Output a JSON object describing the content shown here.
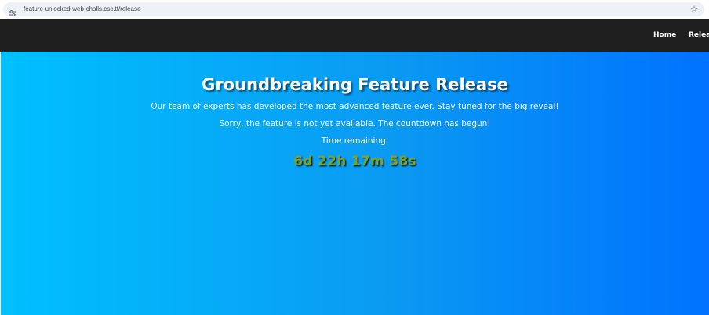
{
  "browser": {
    "url": "feature-unlocked-web-challs.csc.tf/release",
    "site_info_icon": "tune-icon",
    "bookmark_icon": "star-icon"
  },
  "nav": {
    "items": [
      {
        "label": "Home"
      },
      {
        "label": "Release"
      }
    ],
    "background": "#1f1f1f"
  },
  "hero": {
    "title": "Groundbreaking Feature Release",
    "description": "Our team of experts has developed the most advanced feature ever. Stay tuned for the big reveal!",
    "unavailable_message": "Sorry, the feature is not yet available. The countdown has begun!",
    "time_label": "Time remaining:",
    "countdown": "6d 22h 17m 58s",
    "gradient_start": "#00c0ff",
    "gradient_end": "#0072ff",
    "countdown_color": "#7fa32a"
  }
}
